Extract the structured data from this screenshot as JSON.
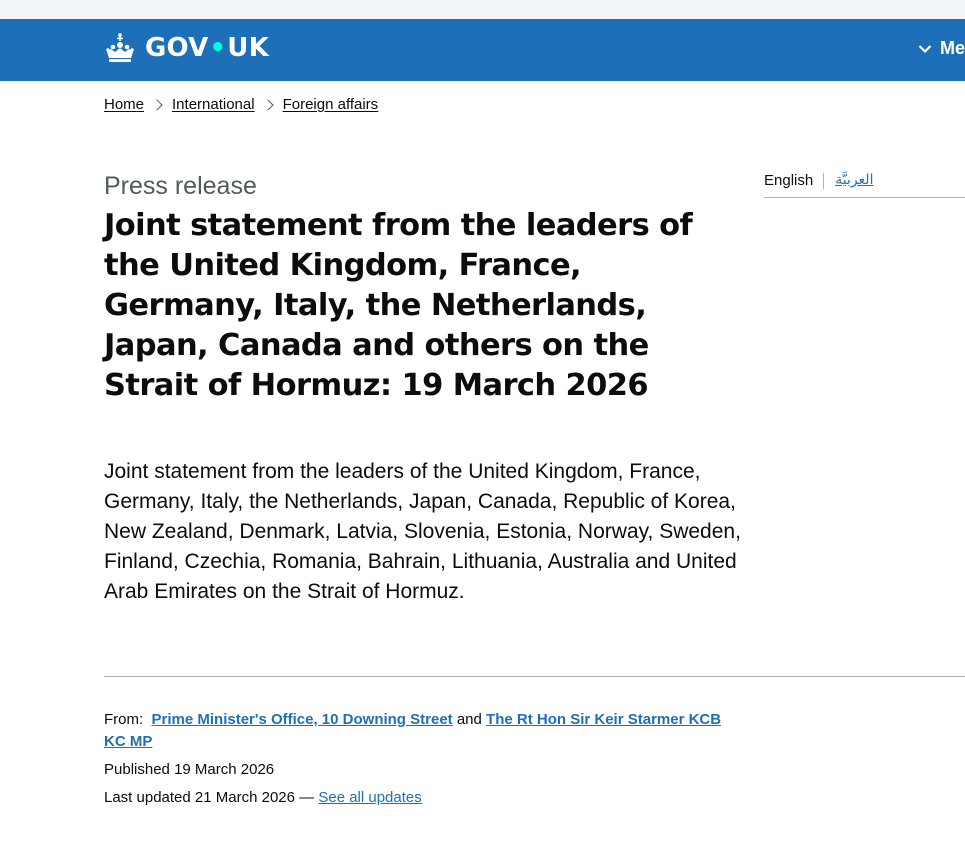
{
  "header": {
    "logo_left": "GOV",
    "logo_dot": "•",
    "logo_right": "UK",
    "menu_label": "Menu",
    "colors": {
      "brand": "#1d70b8",
      "dot": "#00ffe0"
    },
    "icons": {
      "logo": "crown-icon",
      "menu": "chevron-down-icon"
    }
  },
  "breadcrumb": {
    "items": [
      {
        "label": "Home"
      },
      {
        "label": "International"
      },
      {
        "label": "Foreign affairs"
      }
    ]
  },
  "languages": {
    "current": "English",
    "alternate": "العربيَّة"
  },
  "page": {
    "caption": "Press release",
    "title": "Joint statement from the leaders of the United Kingdom, France, Germany, Italy, the Netherlands, Japan, Canada and others on the Strait of Hormuz: 19 March 2026",
    "lead": "Joint statement from the leaders of the United Kingdom, France, Germany, Italy, the Netherlands, Japan, Canada, Republic of Korea, New Zealand, Denmark, Latvia, Slovenia, Estonia, Norway, Sweden, Finland, Czechia, Romania, Bahrain, Lithuania, Australia and United Arab Emirates on the Strait of Hormuz."
  },
  "metadata": {
    "from_label": "From:",
    "orgs": [
      "Prime Minister's Office, 10 Downing Street",
      "The Rt Hon Sir Keir Starmer KCB KC MP"
    ],
    "and_word": "and",
    "published_label": "Published",
    "published_date": "19 March 2026",
    "updated_label": "Last updated",
    "updated_date": "21 March 2026",
    "updated_dash": "—",
    "see_all_updates": "See all updates"
  }
}
